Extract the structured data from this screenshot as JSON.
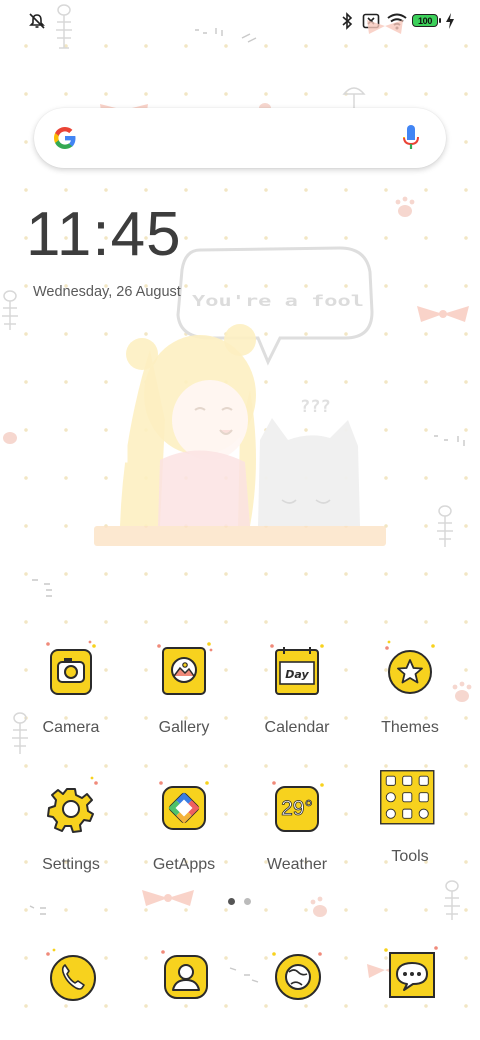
{
  "status_bar": {
    "battery_level": "100",
    "icons": [
      "alarm-off-icon",
      "bluetooth-icon",
      "sim-off-icon",
      "wifi-icon",
      "battery-icon",
      "charging-icon"
    ]
  },
  "search": {
    "logo": "google-logo",
    "mic": "mic-icon"
  },
  "clock": {
    "time": "11:45",
    "date": "Wednesday, 26 August"
  },
  "wallpaper": {
    "bubble_text": "You're a fool",
    "question_marks": "???"
  },
  "apps": [
    {
      "label": "Camera",
      "icon": "camera-icon"
    },
    {
      "label": "Gallery",
      "icon": "gallery-icon"
    },
    {
      "label": "Calendar",
      "icon": "calendar-icon",
      "badge": "Day"
    },
    {
      "label": "Themes",
      "icon": "themes-icon"
    },
    {
      "label": "Settings",
      "icon": "settings-icon"
    },
    {
      "label": "GetApps",
      "icon": "getapps-icon"
    },
    {
      "label": "Weather",
      "icon": "weather-icon",
      "temperature": "29°"
    },
    {
      "label": "Tools",
      "icon": "tools-folder-icon"
    }
  ],
  "pager": {
    "pages": 2,
    "current": 1
  },
  "dock": [
    {
      "icon": "phone-icon"
    },
    {
      "icon": "contacts-icon"
    },
    {
      "icon": "browser-icon"
    },
    {
      "icon": "messages-icon"
    }
  ],
  "colors": {
    "icon_yellow": "#f7d21e",
    "icon_outline": "#2b2b2b",
    "label_gray": "#555555"
  }
}
